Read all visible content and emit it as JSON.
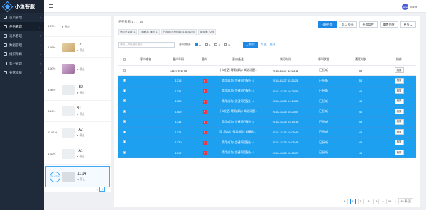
{
  "app": {
    "title": "小鱼客服",
    "user_name": "name",
    "avatar_text": "name"
  },
  "sidebar": {
    "items": [
      {
        "label": "首页管理",
        "icon": "home-icon"
      },
      {
        "label": "任务管理",
        "icon": "list-icon",
        "active": true
      },
      {
        "label": "话术管理",
        "icon": "chat-icon"
      },
      {
        "label": "数据管理",
        "icon": "chart-icon"
      },
      {
        "label": "组织架构",
        "icon": "org-icon"
      },
      {
        "label": "客户管理",
        "icon": "user-icon"
      },
      {
        "label": "要求模版",
        "icon": "doc-icon"
      }
    ]
  },
  "tasks": [
    {
      "pct": "3.29%",
      "name": "",
      "status": "停止"
    },
    {
      "pct": "3.56%",
      "name": "C2",
      "status": "停止"
    },
    {
      "pct": "4.50%",
      "name": "",
      "status": "停止"
    },
    {
      "pct": "5.86%",
      "name": ", B2",
      "status": "停止"
    },
    {
      "pct": "4.16%",
      "name": "B1",
      "status": "停止"
    },
    {
      "pct": "11.91%",
      "name": ", A2",
      "status": "停止"
    },
    {
      "pct": "6.32%",
      "name": ", A1",
      "status": "停止"
    },
    {
      "pct": "38.07%",
      "name": "11.14",
      "status": "停止",
      "selected": true
    }
  ],
  "task_pager": {
    "current": "1"
  },
  "main": {
    "info": "任务名称:1 . . . 14",
    "tags": [
      "外呼总量数: 1",
      "坐席 接 通数: 1",
      "已呼叫/总号码数: 4181/6224",
      "接通率: 72%"
    ],
    "buttons": {
      "start": "开始任务",
      "import": "导入号码",
      "monitor": "任务监控",
      "reset": "重置外呼",
      "more": "更多"
    },
    "filter": {
      "placeholder": "请输入号码进行搜索",
      "level_label": "意向等级:",
      "levels": [
        "A",
        "B",
        "C",
        "D"
      ],
      "search": "搜索",
      "export": "导出",
      "expand": "展开"
    },
    "columns": [
      "",
      "客户姓名",
      "客户号码",
      "意向",
      "意向备注",
      "拨打时间",
      "呼叫状态",
      "通话时长",
      "操作"
    ],
    "rows": [
      {
        "name": "",
        "phone": "13127691756",
        "intent": "",
        "note": "什么东西 得用成功! 关键词提...",
        "time": "2018-11-27 12:23:11",
        "status": "已接听",
        "duration": "59",
        "op": "播放",
        "highlight": false
      },
      {
        "name": "",
        "phone": "1315",
        "intent": "A",
        "note": "得用成功! 关键词匹配分 4",
        "time": "2018-11-27 11:26:24",
        "status": "已接听",
        "duration": "56",
        "op": "播放",
        "highlight": true
      },
      {
        "name": "",
        "phone": "1331",
        "intent": "A",
        "note": "得用成功! 关键词匹配分 4",
        "time": "2018-11-26 19:25:52",
        "status": "已接听",
        "duration": "45",
        "op": "播放",
        "highlight": true
      },
      {
        "name": "",
        "phone": "1359",
        "intent": "A",
        "note": "得用成功! 关键词匹配分 4",
        "time": "2018-11-26 19:14:08",
        "status": "已接听",
        "duration": "45",
        "op": "播放",
        "highlight": true
      },
      {
        "name": "",
        "phone": "1509",
        "intent": "A",
        "note": "什么东西 得用成功! 关键词提...",
        "time": "2018-11-26 15:20:07",
        "status": "已接听",
        "duration": "46",
        "op": "播放",
        "highlight": true
      },
      {
        "name": "",
        "phone": "1331",
        "intent": "A",
        "note": "得用成功! 关键词匹配分 4",
        "time": "2018-11-26 15:14:13",
        "status": "已接听",
        "duration": "48",
        "op": "播放",
        "highlight": true
      },
      {
        "name": "",
        "phone": "1371",
        "intent": "A",
        "note": "是 怎么办 得用成功! 关键词...",
        "time": "2018-11-26 15:09:46",
        "status": "已接听",
        "duration": "45",
        "op": "播放",
        "highlight": true
      },
      {
        "name": "",
        "phone": "1370",
        "intent": "A",
        "note": "得用成功! 关键词匹配分 4",
        "time": "2018-11-26 15:05:48",
        "status": "已接听",
        "duration": "45",
        "op": "播放",
        "highlight": true
      },
      {
        "name": "",
        "phone": "1317",
        "intent": "A",
        "note": "得用成功! 关键词匹配分 4",
        "time": "2018-11-26 15:02:27",
        "status": "已接听",
        "duration": "45",
        "op": "播放",
        "highlight": true
      }
    ],
    "pager": {
      "pages": [
        "1",
        "2",
        "3",
        "4",
        "5",
        "...",
        "11"
      ],
      "current": "2",
      "goto": "15 条/页"
    }
  }
}
